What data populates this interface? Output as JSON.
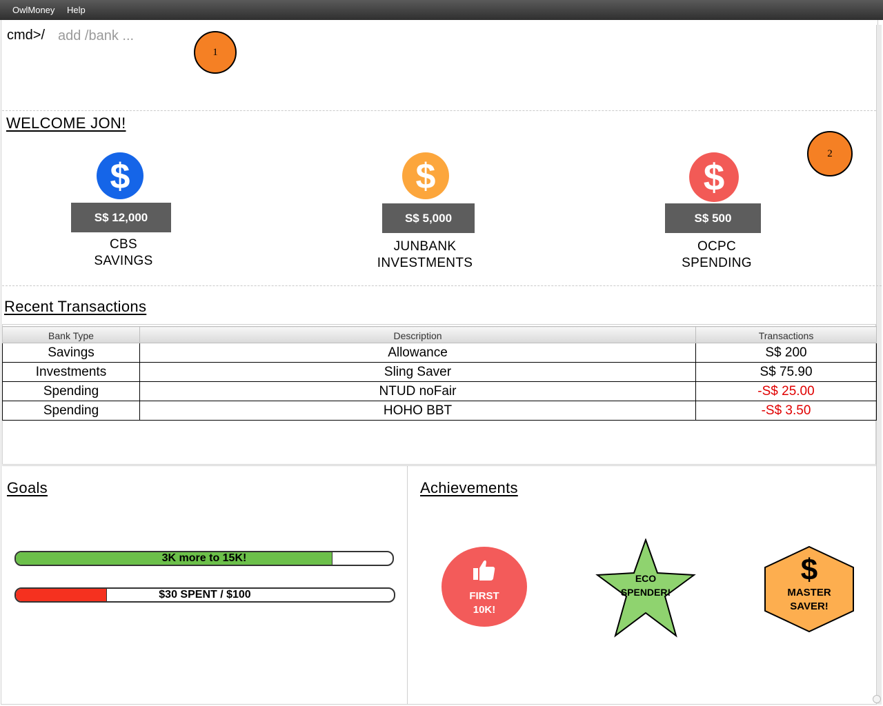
{
  "menubar": {
    "items": [
      "OwlMoney",
      "Help"
    ]
  },
  "command": {
    "prompt": "cmd>/",
    "placeholder": "add /bank ..."
  },
  "callouts": [
    "1",
    "2"
  ],
  "welcome": {
    "title": "WELCOME JON!"
  },
  "accounts": [
    {
      "balance": "S$ 12,000",
      "name": "CBS",
      "type": "SAVINGS",
      "color": "#1565e8",
      "icon": "dollar-icon"
    },
    {
      "balance": "S$ 5,000",
      "name": "JUNBANK",
      "type": "INVESTMENTS",
      "color": "#fca63c",
      "icon": "dollar-icon"
    },
    {
      "balance": "S$ 500",
      "name": "OCPC",
      "type": "SPENDING",
      "color": "#f25a56",
      "icon": "dollar-icon"
    }
  ],
  "transactions": {
    "title": "Recent Transactions",
    "columns": [
      "Bank Type",
      "Description",
      "Transactions"
    ],
    "rows": [
      {
        "bank_type": "Savings",
        "description": "Allowance",
        "amount": "S$ 200",
        "negative": false
      },
      {
        "bank_type": "Investments",
        "description": "Sling Saver",
        "amount": "S$ 75.90",
        "negative": false
      },
      {
        "bank_type": "Spending",
        "description": "NTUD noFair",
        "amount": "-S$ 25.00",
        "negative": true
      },
      {
        "bank_type": "Spending",
        "description": "HOHO BBT",
        "amount": "-S$ 3.50",
        "negative": true
      }
    ],
    "negative_color": "#e00000"
  },
  "goals": {
    "title": "Goals",
    "items": [
      {
        "label": "3K more to 15K!",
        "progress": 0.84,
        "color": "#6cc04a"
      },
      {
        "label": "$30 SPENT / $100",
        "progress": 0.24,
        "color": "#f5311f"
      }
    ]
  },
  "achievements": {
    "title": "Achievements",
    "items": [
      {
        "line1": "FIRST",
        "line2": "10K!",
        "shape": "circle",
        "color": "#f35b5a",
        "icon": "thumbs-up-icon"
      },
      {
        "line1": "ECO",
        "line2": "SPENDER!",
        "shape": "star",
        "color": "#8fd36f"
      },
      {
        "line1": "MASTER",
        "line2": "SAVER!",
        "shape": "hexagon",
        "color": "#fdae4f",
        "icon": "dollar-icon"
      }
    ]
  }
}
